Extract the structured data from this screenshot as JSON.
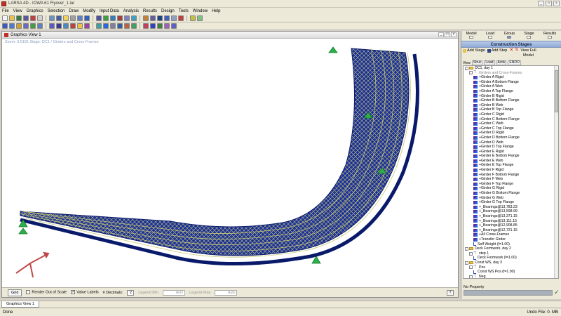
{
  "window": {
    "title": "LARSA 4D - IOWA 61 Flyover_1.lar",
    "btn_min": "_",
    "btn_max": "□",
    "btn_close": "×"
  },
  "menu": [
    "File",
    "View",
    "Graphics",
    "Selection",
    "Draw",
    "Modify",
    "Input Data",
    "Analysis",
    "Results",
    "Design",
    "Tools",
    "Window",
    "Help"
  ],
  "graphics_view": {
    "title": "Graphics View 1",
    "zoom_info": "Zoom: 3.6181    Stage: DC1 / Girders and Cross-Frames",
    "footer": {
      "grid_label": "Grid",
      "render_out_of_scale": "Render Out of Scale",
      "value_labels": "Value Labels",
      "decimals_label": "# Decimals:",
      "decimals_value": "2",
      "legend_min_label": "Legend Min",
      "legend_min_value": "Auto",
      "legend_max_label": "Legend Max",
      "legend_max_value": "Auto",
      "help": "?"
    }
  },
  "right_panel": {
    "tabs": [
      {
        "label": "Model",
        "selected": false
      },
      {
        "label": "Load",
        "selected": false
      },
      {
        "label": "Group",
        "selected": true
      },
      {
        "label": "Stage",
        "selected": false
      },
      {
        "label": "Results",
        "selected": false
      }
    ],
    "header": "Construction Stages",
    "tools": {
      "add_stage": "Add Stage",
      "add_step": "Add Step",
      "view_full": "View Full",
      "model": "Model",
      "view": "View"
    },
    "columns": [
      "Struc",
      "Load",
      "Activ",
      "ENDO"
    ],
    "tree": [
      {
        "level": 0,
        "type": "folder",
        "text": "DC1, day 1",
        "exp": "-"
      },
      {
        "level": 1,
        "type": "step",
        "text": "Girders and Cross-Frames",
        "grey": true,
        "exp": "-"
      },
      {
        "level": 2,
        "type": "item",
        "text": "+Girder A Rigid"
      },
      {
        "level": 2,
        "type": "item",
        "text": "+Girder A Bottom Flange"
      },
      {
        "level": 2,
        "type": "item",
        "text": "+Girder A Web"
      },
      {
        "level": 2,
        "type": "item",
        "text": "+Girder A Top Flange"
      },
      {
        "level": 2,
        "type": "item",
        "text": "+Girder B Rigid"
      },
      {
        "level": 2,
        "type": "item",
        "text": "+Girder B Bottom Flange"
      },
      {
        "level": 2,
        "type": "item",
        "text": "+Girder B Web"
      },
      {
        "level": 2,
        "type": "item",
        "text": "+Girder B Top Flange"
      },
      {
        "level": 2,
        "type": "item",
        "text": "+Girder C Rigid"
      },
      {
        "level": 2,
        "type": "item",
        "text": "+Girder C Bottom Flange"
      },
      {
        "level": 2,
        "type": "item",
        "text": "+Girder C Web"
      },
      {
        "level": 2,
        "type": "item",
        "text": "+Girder C Top Flange"
      },
      {
        "level": 2,
        "type": "item",
        "text": "+Girder D Rigid"
      },
      {
        "level": 2,
        "type": "item",
        "text": "+Girder D Bottom Flange"
      },
      {
        "level": 2,
        "type": "item",
        "text": "+Girder D Web"
      },
      {
        "level": 2,
        "type": "item",
        "text": "+Girder D Top Flange"
      },
      {
        "level": 2,
        "type": "item",
        "text": "+Girder E Rigid"
      },
      {
        "level": 2,
        "type": "item",
        "text": "+Girder E Bottom Flange"
      },
      {
        "level": 2,
        "type": "item",
        "text": "+Girder E Web"
      },
      {
        "level": 2,
        "type": "item",
        "text": "+Girder E Top Flange"
      },
      {
        "level": 2,
        "type": "item",
        "text": "+Girder F Rigid"
      },
      {
        "level": 2,
        "type": "item",
        "text": "+Girder F Bottom Flange"
      },
      {
        "level": 2,
        "type": "item",
        "text": "+Girder F Web"
      },
      {
        "level": 2,
        "type": "item",
        "text": "+Girder F Top Flange"
      },
      {
        "level": 2,
        "type": "item",
        "text": "+Girder G Rigid"
      },
      {
        "level": 2,
        "type": "item",
        "text": "+Girder G Bottom Flange"
      },
      {
        "level": 2,
        "type": "item",
        "text": "+Girder G Web"
      },
      {
        "level": 2,
        "type": "item",
        "text": "+Girder G Top Flange"
      },
      {
        "level": 2,
        "type": "item",
        "text": "+_Bearings@13,783.23"
      },
      {
        "level": 2,
        "type": "item",
        "text": "+_Bearings@13,598.99"
      },
      {
        "level": 2,
        "type": "item",
        "text": "+_Bearings@13,371.15"
      },
      {
        "level": 2,
        "type": "item",
        "text": "+_Bearings@13,111.15"
      },
      {
        "level": 2,
        "type": "item",
        "text": "+_Bearings@12,908.85"
      },
      {
        "level": 2,
        "type": "item",
        "text": "+_Bearings@12,721.15"
      },
      {
        "level": 2,
        "type": "item",
        "text": "+All Cross-Frames"
      },
      {
        "level": 2,
        "type": "item",
        "text": "+Transfer Girder"
      },
      {
        "level": 2,
        "type": "load",
        "text": "Self Weight (f=1.00)"
      },
      {
        "level": 0,
        "type": "folder",
        "text": "Deck Formwork, day 2",
        "exp": "-"
      },
      {
        "level": 1,
        "type": "step",
        "text": "step 1",
        "exp": "-"
      },
      {
        "level": 2,
        "type": "load",
        "text": "Deck Formwork (f=1.00)"
      },
      {
        "level": 0,
        "type": "folder",
        "text": "Const WS, day 3",
        "exp": "-"
      },
      {
        "level": 1,
        "type": "step",
        "text": "Pos",
        "exp": "-"
      },
      {
        "level": 2,
        "type": "load",
        "text": "Const WS Pos (f=1.00)"
      },
      {
        "level": 1,
        "type": "step",
        "text": "Neg",
        "exp": "-"
      },
      {
        "level": 2,
        "type": "load",
        "text": "Const WS Neg (f=1.00)"
      }
    ],
    "property_label": "No Property"
  },
  "doc_tab": "Graphics View 1",
  "status": {
    "left": "Done",
    "right": "Undo File: 0. MB"
  },
  "colors": {
    "girder": "#1a2f9a",
    "frame": "#c8c870",
    "support": "#2ab04a",
    "axis": "#c04a4a"
  },
  "scene": {
    "ghost_left_end_label": ""
  }
}
